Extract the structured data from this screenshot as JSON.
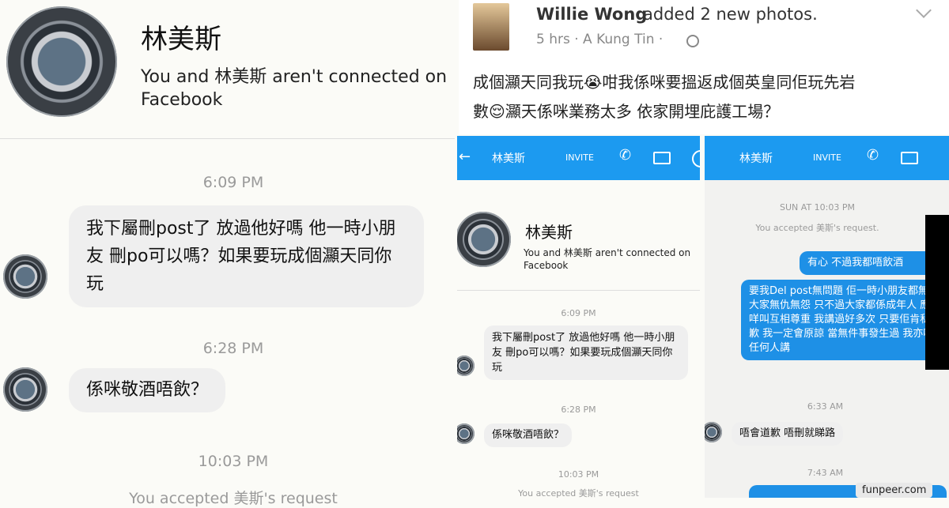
{
  "left": {
    "contact_name": "林美斯",
    "not_connected": "You and 林美斯 aren't connected on Facebook",
    "time1": "6:09 PM",
    "msg1": "我下屬刪post了 放過他好嗎 他一時小朋友 刪po可以嗎？如果要玩成個灦天同你玩",
    "time2": "6:28 PM",
    "msg2": "係咪敬酒唔飲？",
    "time3": "10:03 PM",
    "accepted": "You accepted 美斯's request"
  },
  "post": {
    "author": "Willie Wong",
    "action": "added 2 new photos.",
    "meta": "5 hrs · A Kung Tin ·",
    "text_line1": "成個灦天同我玩😭咁我係咪要搵返成個英皇同佢玩先岩",
    "text_line2": "數😌灦天係咪業務太多 依家開埋庇護工場？"
  },
  "shot1": {
    "name": "林美斯",
    "invite": "INVITE",
    "contact_name": "林美斯",
    "not_connected": "You and 林美斯 aren't connected on Facebook",
    "time1": "6:09 PM",
    "msg1": "我下屬刪post了 放過他好嗎 他一時小朋友 刪po可以嗎？如果要玩成個灦天同你玩",
    "time2": "6:28 PM",
    "msg2": "係咪敬酒唔飲？",
    "time3": "10:03 PM",
    "accepted": "You accepted 美斯's request"
  },
  "shot2": {
    "name": "林美斯",
    "invite": "INVITE",
    "time1": "SUN AT 10:03 PM",
    "accepted": "You accepted 美斯's request.",
    "mine1": "有心 不過我都唔飲酒",
    "mine2": "要我Del post無問題 佢一時小朋友都無問題 大家無仇無怨 只不過大家都係成年人 應該知咩叫互相尊重 我講過好多次 只要佢肯私下道歉 我一定會原諒 當無件事發生過 我亦唔會同任何人講",
    "time2": "6:33 AM",
    "theirs1": "唔會道歉 唔刪就睇路",
    "time3": "7:43 AM"
  },
  "watermark": "funpeer.com",
  "colors": {
    "messenger_blue": "#1c9af0",
    "sent_bubble": "#1e90e6"
  }
}
